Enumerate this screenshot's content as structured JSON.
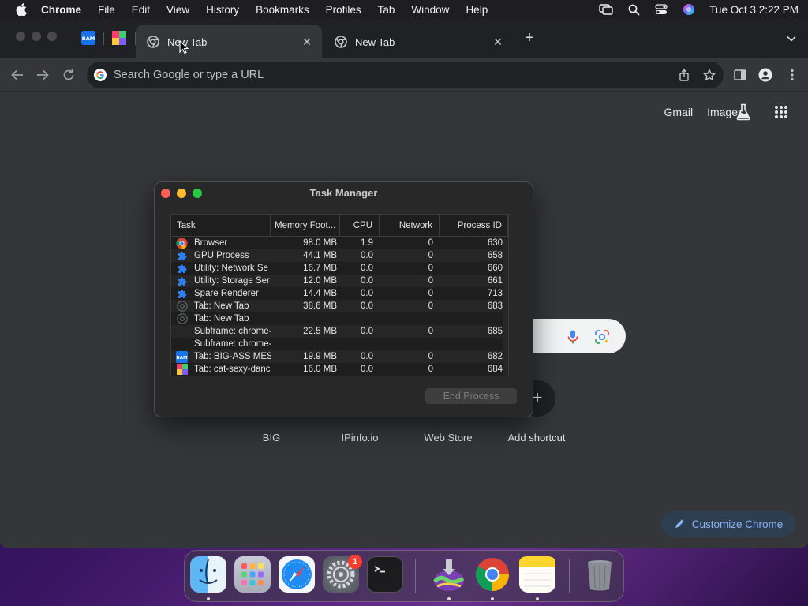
{
  "menubar": {
    "app_name": "Chrome",
    "items": [
      "File",
      "Edit",
      "View",
      "History",
      "Bookmarks",
      "Profiles",
      "Tab",
      "Window",
      "Help"
    ],
    "clock": "Tue Oct 3  2:22 PM"
  },
  "tabs": [
    {
      "title": "New Tab",
      "active": true
    },
    {
      "title": "New Tab",
      "active": false
    }
  ],
  "omnibox": {
    "placeholder": "Search Google or type a URL"
  },
  "ntp": {
    "links": [
      "Gmail",
      "Images"
    ],
    "shortcuts": [
      "BIG",
      "IPinfo.io",
      "Web Store",
      "Add shortcut"
    ],
    "customize_label": "Customize Chrome",
    "add_shortcut_symbol": "+"
  },
  "task_manager": {
    "title": "Task Manager",
    "columns": [
      "Task",
      "Memory Foot...",
      "CPU",
      "Network",
      "Process ID"
    ],
    "rows": [
      {
        "icon": "chrome-icon",
        "task": "Browser",
        "memory": "98.0 MB",
        "cpu": "1.9",
        "network": "0",
        "pid": "630"
      },
      {
        "icon": "puzzle-icon",
        "task": "GPU Process",
        "memory": "44.1 MB",
        "cpu": "0.0",
        "network": "0",
        "pid": "658"
      },
      {
        "icon": "puzzle-icon",
        "task": "Utility: Network Se",
        "memory": "16.7 MB",
        "cpu": "0.0",
        "network": "0",
        "pid": "660"
      },
      {
        "icon": "puzzle-icon",
        "task": "Utility: Storage Ser",
        "memory": "12.0 MB",
        "cpu": "0.0",
        "network": "0",
        "pid": "661"
      },
      {
        "icon": "puzzle-icon",
        "task": "Spare Renderer",
        "memory": "14.4 MB",
        "cpu": "0.0",
        "network": "0",
        "pid": "713"
      },
      {
        "icon": "chrome-gray-icon",
        "task": "Tab: New Tab",
        "memory": "38.6 MB",
        "cpu": "0.0",
        "network": "0",
        "pid": "683"
      },
      {
        "icon": "chrome-gray-icon",
        "task": "Tab: New Tab",
        "memory": "",
        "cpu": "",
        "network": "",
        "pid": ""
      },
      {
        "icon": "",
        "task": "Subframe: chrome-",
        "memory": "22.5 MB",
        "cpu": "0.0",
        "network": "0",
        "pid": "685"
      },
      {
        "icon": "",
        "task": "Subframe: chrome-",
        "memory": "",
        "cpu": "",
        "network": "",
        "pid": ""
      },
      {
        "icon": "bam-icon",
        "task": "Tab: BIG-ASS MES",
        "memory": "19.9 MB",
        "cpu": "0.0",
        "network": "0",
        "pid": "682"
      },
      {
        "icon": "colorful-grid-icon",
        "task": "Tab: cat-sexy-danc",
        "memory": "16.0 MB",
        "cpu": "0.0",
        "network": "0",
        "pid": "684"
      }
    ],
    "end_process_label": "End Process"
  },
  "dock": {
    "apps": [
      "Finder",
      "Launchpad",
      "Safari",
      "System Settings",
      "Terminal",
      "Image Tool",
      "Google Chrome",
      "Notes",
      "Trash"
    ],
    "settings_badge": "1"
  },
  "colors": {
    "chrome_bg": "#35363a",
    "tabstrip_bg": "#202124",
    "accent_blue": "#8ab4f8",
    "red_light": "#ff5f57",
    "yellow_light": "#febc2e",
    "green_light": "#28c840"
  }
}
